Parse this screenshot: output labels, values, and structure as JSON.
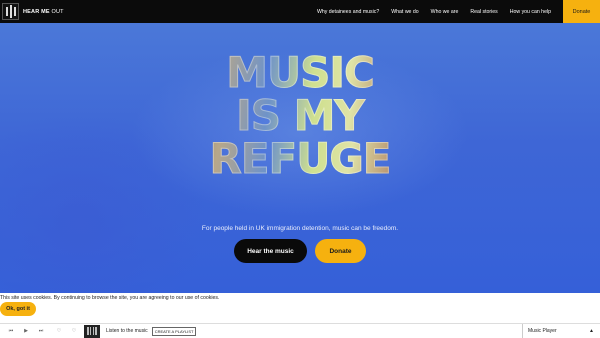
{
  "header": {
    "brand_bold": "HEAR ME",
    "brand_light": "OUT",
    "nav": [
      "Why detainees and music?",
      "What we do",
      "Who we are",
      "Real stories",
      "How you can help"
    ],
    "donate_label": "Donate"
  },
  "hero": {
    "headline": [
      "MUSIC",
      "IS MY",
      "REFUGE"
    ],
    "tagline": "For people held in UK immigration detention, music can be freedom.",
    "primary_button": "Hear the music",
    "secondary_button": "Donate"
  },
  "cookie": {
    "text": "This site uses cookies. By continuing to browse the site, you are agreeing to our use of cookies.",
    "button": "Ok, got it"
  },
  "player": {
    "listen_text": "Listen to the music",
    "playlist_button": "CREATE A PLAYLIST",
    "panel_title": "Music Player",
    "icons": [
      "skip-back-icon",
      "play-icon",
      "skip-forward-icon",
      "heart-icon",
      "heart-outline-icon",
      "chevron-up-icon"
    ]
  },
  "colors": {
    "accent": "#f6b10f",
    "header_bg": "#0b0b0b",
    "hero_blue": "#3f62d8"
  }
}
